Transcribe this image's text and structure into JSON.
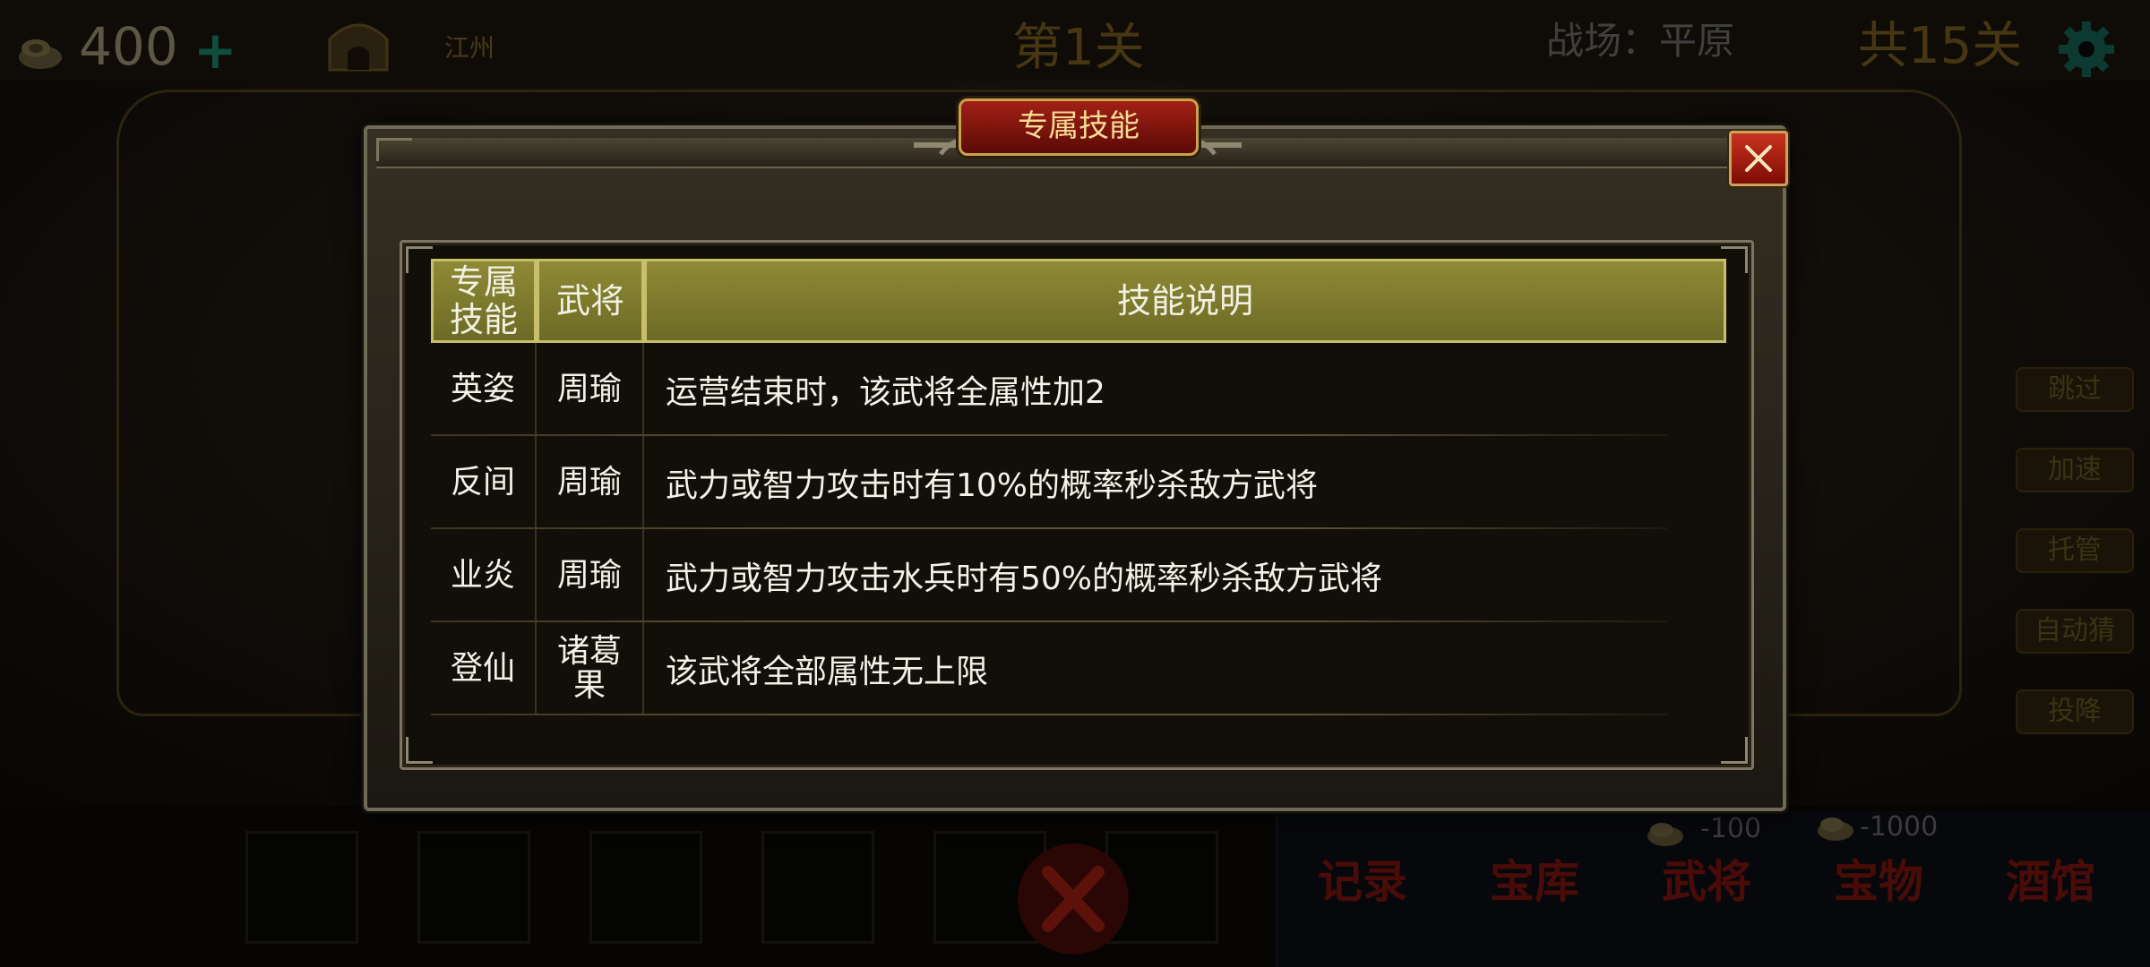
{
  "topbar": {
    "gold": "400",
    "plus": "+",
    "city": "江州",
    "stage": "第1关",
    "battlefield": "战场：平原",
    "total_stages": "共15关"
  },
  "side_buttons": [
    "跳过",
    "加速",
    "托管",
    "自动猜",
    "投降"
  ],
  "shop": {
    "costs": [
      "-100",
      "-1000"
    ],
    "buttons": [
      "记录",
      "宝库",
      "武将",
      "宝物",
      "酒馆"
    ]
  },
  "dialog": {
    "title": "专属技能",
    "close_icon": "close-icon",
    "headers": {
      "skill_line1": "专属",
      "skill_line2": "技能",
      "general": "武将",
      "description": "技能说明"
    },
    "rows": [
      {
        "skill": "英姿",
        "general": "周瑜",
        "description": "运营结束时，该武将全属性加2"
      },
      {
        "skill": "反间",
        "general": "周瑜",
        "description": "武力或智力攻击时有10%的概率秒杀敌方武将"
      },
      {
        "skill": "业炎",
        "general": "周瑜",
        "description": "武力或智力攻击水兵时有50%的概率秒杀敌方武将"
      },
      {
        "skill": "登仙",
        "general_line1": "诸葛",
        "general_line2": "果",
        "description": "该武将全部属性无上限"
      }
    ]
  },
  "colors": {
    "header_fill": "#7d7a2e",
    "banner_red": "#a22016",
    "close_red": "#c9321f",
    "text": "#f4f1e8"
  }
}
